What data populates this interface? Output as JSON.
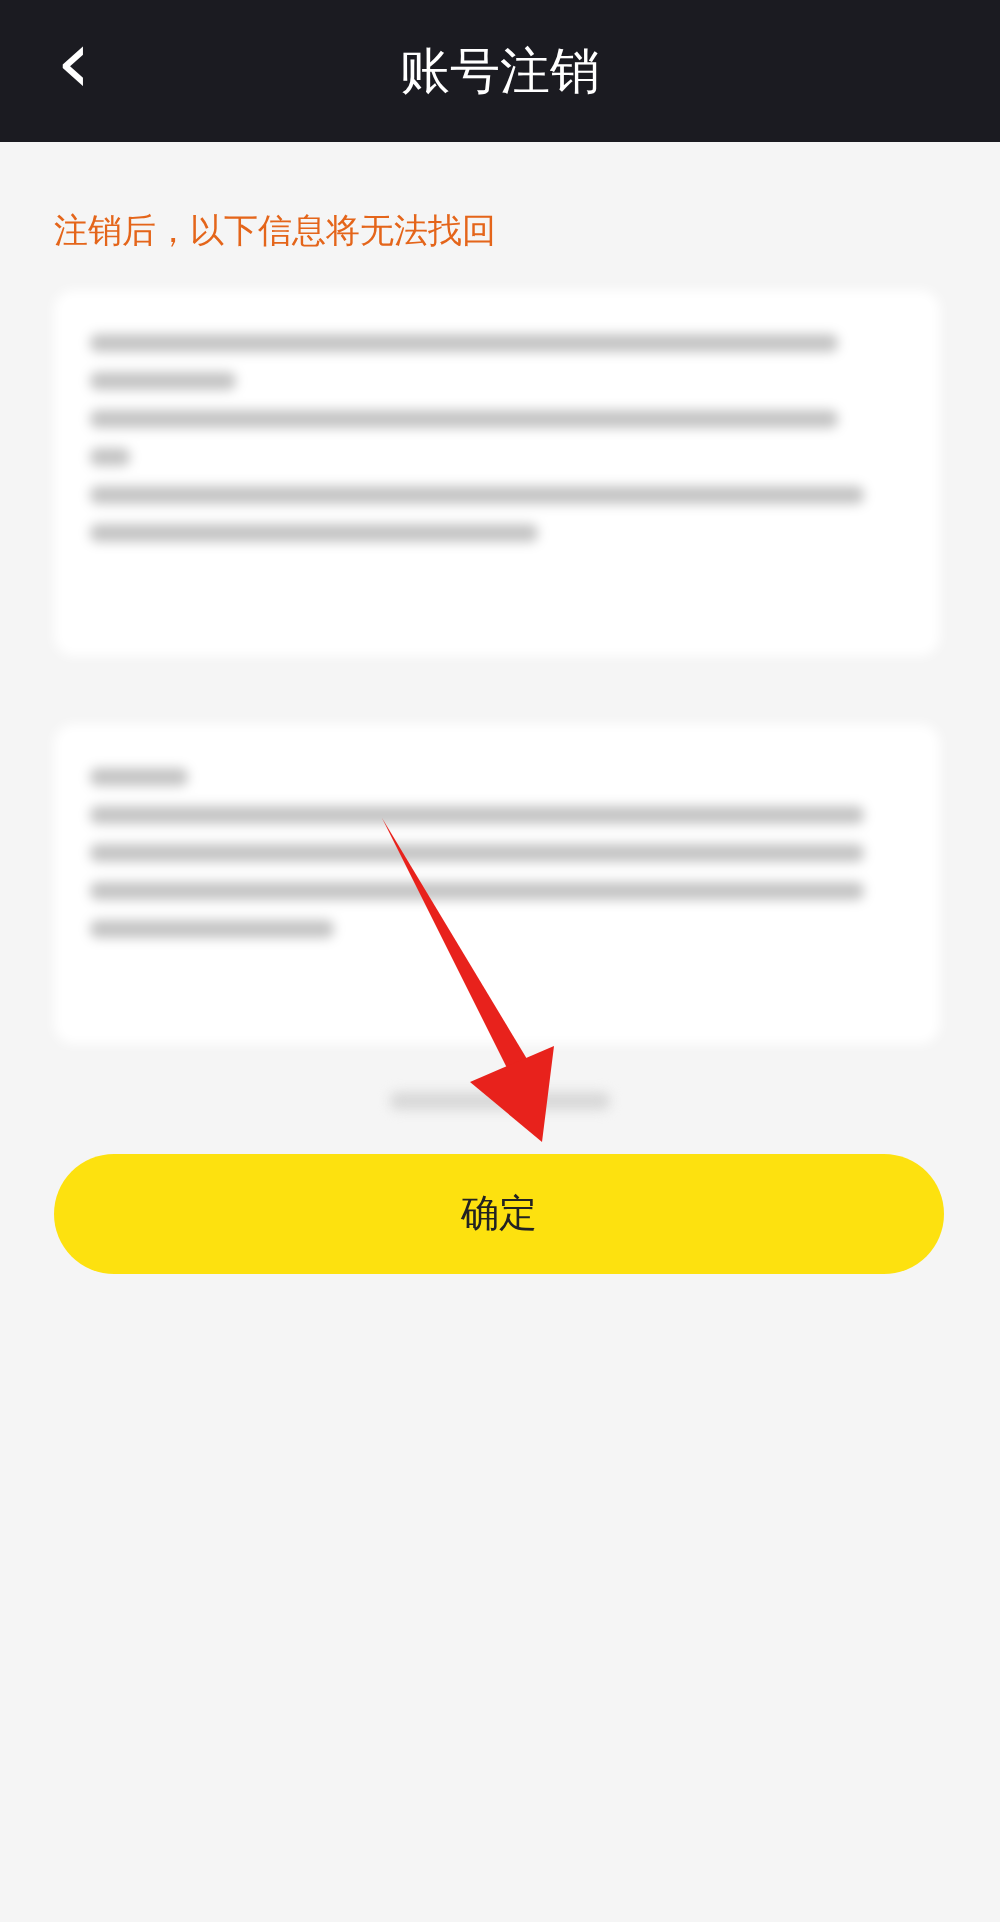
{
  "header": {
    "back_icon": "‹",
    "title": "账号注销"
  },
  "notice": "注销后，以下信息将无法找回",
  "confirm_button": {
    "label": "确定"
  }
}
